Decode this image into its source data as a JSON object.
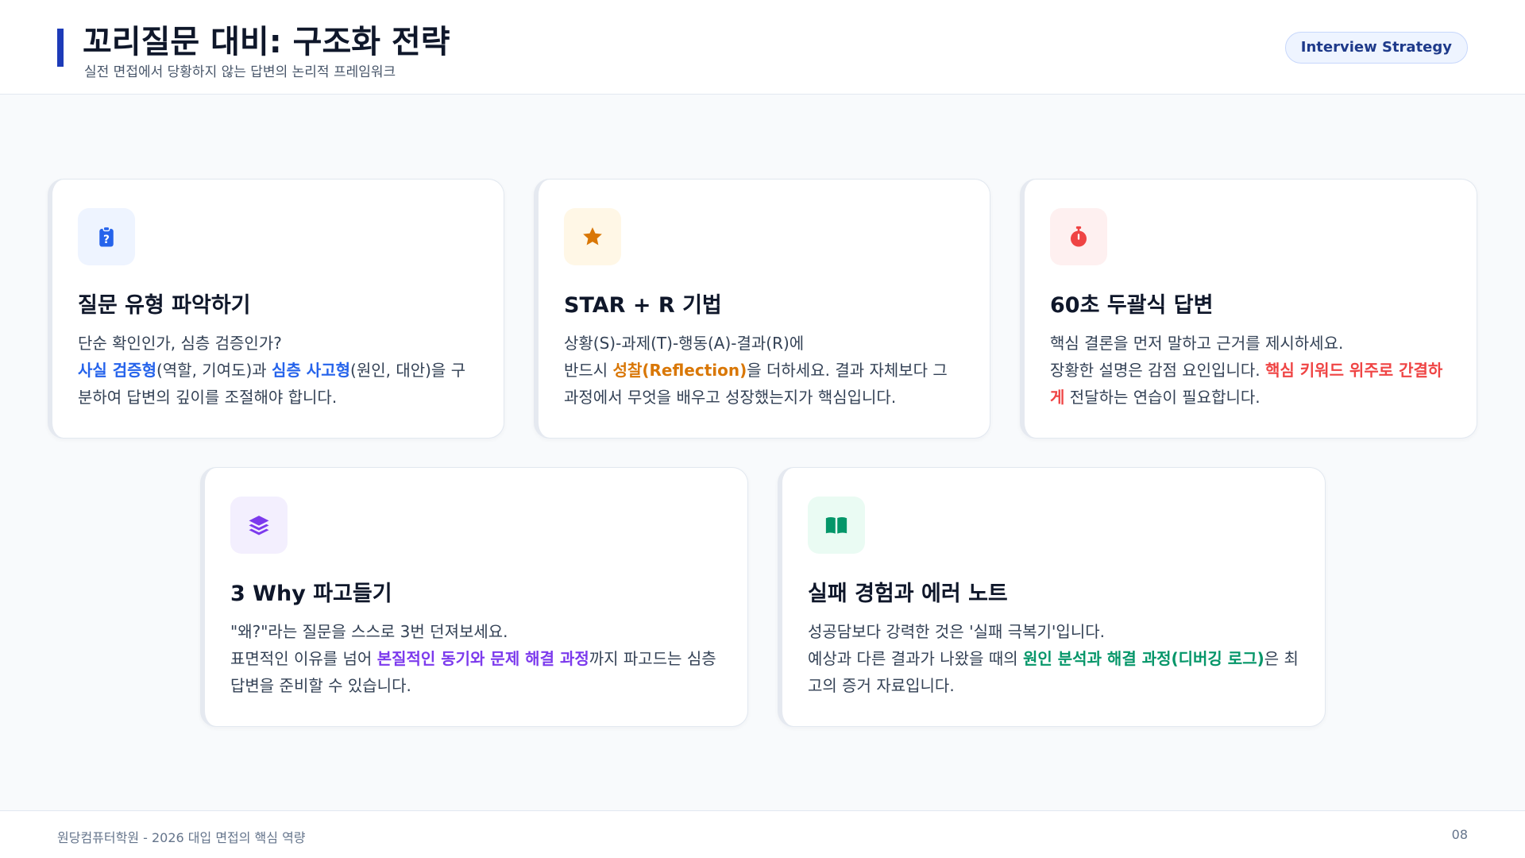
{
  "header": {
    "title": "꼬리질문 대비: 구조화 전략",
    "subtitle": "실전 면접에서 당황하지 않는 답변의 논리적 프레임워크",
    "badge": "Interview Strategy"
  },
  "colors": {
    "accent": "#1d3bb8",
    "blue": "#2563eb",
    "orange": "#d97706",
    "red": "#ef4444",
    "purple": "#7c3aed",
    "green": "#059669"
  },
  "cards": [
    {
      "icon": "clipboard-question-icon",
      "title": "질문 유형 파악하기",
      "desc": {
        "line1": "단순 확인인가, 심층 검증인가?",
        "hl1": "사실 검증형",
        "t1": "(역할, 기여도)과 ",
        "hl2": "심층 사고형",
        "t2": "(원인, 대안)을 구분하여 답변의 깊이를 조절해야 합니다."
      }
    },
    {
      "icon": "star-icon",
      "title": "STAR + R 기법",
      "desc": {
        "line1": "상황(S)-과제(T)-행동(A)-결과(R)에",
        "t0": "반드시 ",
        "hl1": "성찰(Reflection)",
        "t1": "을 더하세요. 결과 자체보다 그 과정에서 무엇을 배우고 성장했는지가 핵심입니다."
      }
    },
    {
      "icon": "stopwatch-icon",
      "title": "60초 두괄식 답변",
      "desc": {
        "line1": "핵심 결론을 먼저 말하고 근거를 제시하세요.",
        "t0": "장황한 설명은 감점 요인입니다. ",
        "hl1": "핵심 키워드 위주로 간결하게",
        "t1": " 전달하는 연습이 필요합니다."
      }
    },
    {
      "icon": "layers-icon",
      "title": "3 Why 파고들기",
      "desc": {
        "line1": "\"왜?\"라는 질문을 스스로 3번 던져보세요.",
        "t0": "표면적인 이유를 넘어 ",
        "hl1": "본질적인 동기와 문제 해결 과정",
        "t1": "까지 파고드는 심층 답변을 준비할 수 있습니다."
      }
    },
    {
      "icon": "open-book-icon",
      "title": "실패 경험과 에러 노트",
      "desc": {
        "line1": "성공담보다 강력한 것은 '실패 극복기'입니다.",
        "t0": "예상과 다른 결과가 나왔을 때의 ",
        "hl1": "원인 분석과 해결 과정(디버깅 로그)",
        "t1": "은 최고의 증거 자료입니다."
      }
    }
  ],
  "footer": {
    "text": "원당컴퓨터학원 - 2026 대입 면접의 핵심 역량",
    "page": "08"
  }
}
